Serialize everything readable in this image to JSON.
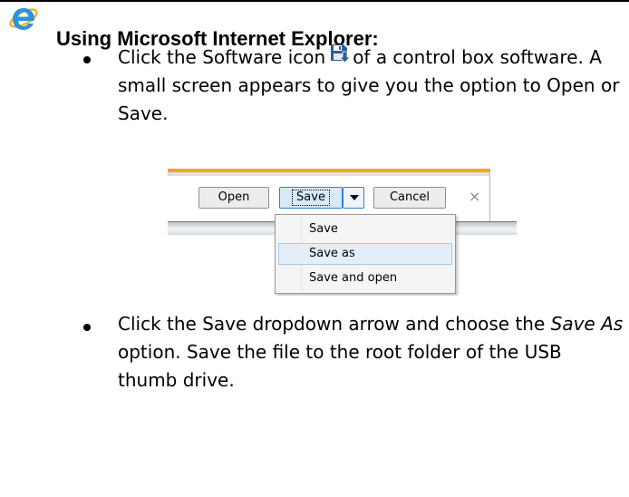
{
  "section": {
    "heading": "Using Microsoft Internet Explorer:",
    "browser_icon": "internet-explorer-logo-icon",
    "brand_color": "#2e93d8"
  },
  "steps": [
    {
      "text_before_icon": "Click the Software icon",
      "icon": "software-save-icon",
      "text_after_icon": "of a control box software. A small screen appears to give you the option to Open or Save."
    },
    {
      "text_before_italic": "Click the Save dropdown arrow and choose the",
      "italic_text": "Save As",
      "text_after_italic": "option. Save the file to the root folder of the USB thumb drive."
    }
  ],
  "dialog": {
    "open_label": "Open",
    "save_label": "Save",
    "cancel_label": "Cancel",
    "close_glyph": "×",
    "menu_items": [
      "Save",
      "Save as",
      "Save and open"
    ],
    "highlighted_item": "Save as",
    "accent_color": "#f0a81e"
  }
}
